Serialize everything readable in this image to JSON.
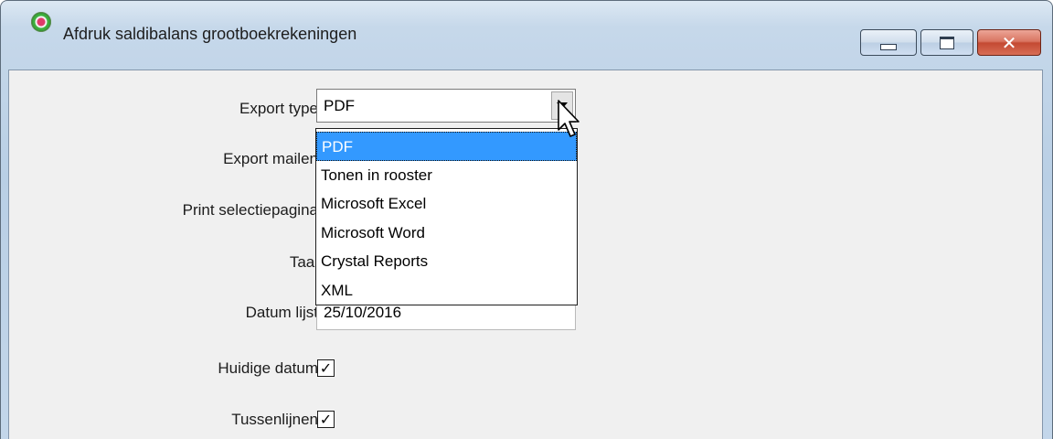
{
  "window": {
    "title": "Afdruk saldibalans grootboekrekeningen",
    "icon": "app-icon",
    "controls": [
      "minimize-button",
      "maximize-button",
      "close-button"
    ]
  },
  "form": {
    "export_type": {
      "label": "Export type",
      "value": "PDF"
    },
    "export_mailen": {
      "label": "Export mailen"
    },
    "print_selectiepagina": {
      "label": "Print selectiepagina"
    },
    "taal": {
      "label": "Taal"
    },
    "datum_lijst": {
      "label": "Datum lijst",
      "value": "25/10/2016"
    },
    "huidige_datum": {
      "label": "Huidige datum",
      "checked": true
    },
    "tussenlijnen": {
      "label": "Tussenlijnen",
      "checked": true
    }
  },
  "dropdown": {
    "options": [
      "PDF",
      "Tonen in rooster",
      "Microsoft Excel",
      "Microsoft Word",
      "Crystal Reports",
      "XML"
    ],
    "selected_index": 0
  },
  "colors": {
    "selection": "#3399ff",
    "close_button": "#c44a33",
    "frame": "#c3d6ea"
  }
}
